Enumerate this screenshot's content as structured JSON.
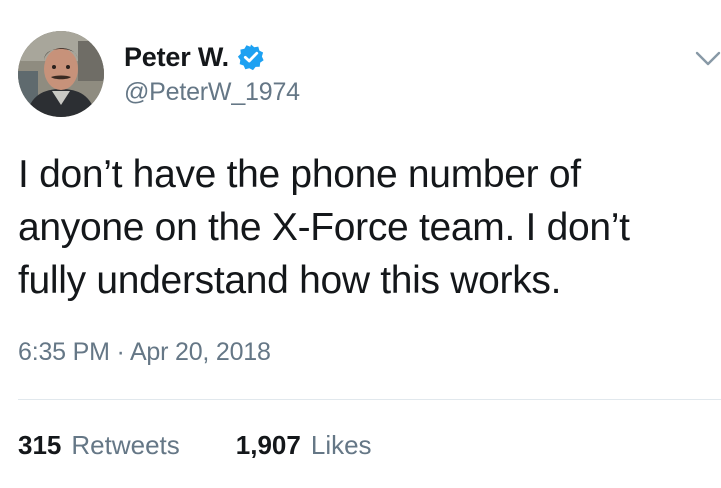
{
  "author": {
    "display_name": "Peter W.",
    "handle": "@PeterW_1974",
    "verified": true
  },
  "tweet": {
    "lines": [
      "I don’t have the phone number of",
      "anyone on the X-Force team. I don’t",
      "fully understand how this works."
    ],
    "timestamp": "6:35 PM · Apr 20, 2018"
  },
  "stats": {
    "retweets_count": "315",
    "retweets_label": "Retweets",
    "likes_count": "1,907",
    "likes_label": "Likes"
  },
  "icons": {
    "verified_badge": "verified-badge-icon",
    "menu": "chevron-down-icon"
  },
  "colors": {
    "verified_blue": "#1da1f2",
    "secondary_text": "#657786",
    "primary_text": "#14171a",
    "divider": "#e1e8ed"
  }
}
